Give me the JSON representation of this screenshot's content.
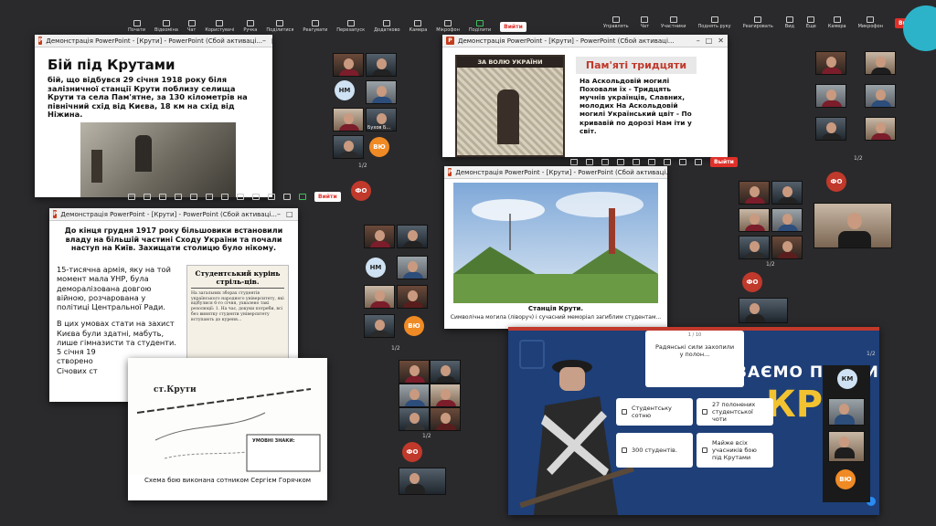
{
  "toolbar_left": {
    "items": [
      "Почати",
      "Відеоміна",
      "Чат",
      "Користувачі",
      "Ручка",
      "Поділитися",
      "Реагувати",
      "Перезапуск",
      "Додатково"
    ],
    "camera": "Камера",
    "mic": "Мікрофон",
    "sub": "Поділити",
    "leave": "Вийти"
  },
  "toolbar_right": {
    "items": [
      "Управлять",
      "Чат",
      "Участники",
      "Поднять руку",
      "Реагировать",
      "Вид",
      "Еще"
    ],
    "camera": "Камера",
    "mic": "Микрофон",
    "leave": "Выйти",
    "count": "17"
  },
  "win1": {
    "title": "Демонстрація PowerPoint - [Крути] - PowerPoint (Сбой активаці...",
    "heading": "Бій під Крутами",
    "body": "бій, що відбувся 29 січня 1918 року біля залізничної станції Крути поблизу селища Крути та села Пам'ятне, за 130 кілометрів на північний схід від Києва, 18 км на схід від Ніжина."
  },
  "win2": {
    "title": "Демонстрація PowerPoint - [Крути] - PowerPoint (Сбой активаці...",
    "lead": "До кінця грудня 1917 року більшовики встановили владу на більшій частині Сходу України та почали наступ на Київ. Захищати столицю було нікому.",
    "para1": "15-тисячна армія, яку на той момент мала УНР, була деморалізована довгою війною, розчарована у політиці Центральної Ради.",
    "para2": "В цих умовах стати на захист Києва були здатні, мабуть, лише гімназисти та студенти.",
    "date_partial": "5 січня 19",
    "created_partial": "створено",
    "sich_partial": "Січових ст",
    "newspaper_title": "Студентський курінь стріль-ців.",
    "newspaper_text": "На загальних зборах студентів українського народного університету, які відбулися 6-го січня, ухвалено такі резолюції: 1. На час, докуки потреби, всі без винятку студенти університету вступають до куреня..."
  },
  "map": {
    "station": "ст.Крути",
    "legend": "УМОВНІ ЗНАКИ:",
    "caption": "Схема бою виконана сотником Сергієм Горячком"
  },
  "win3": {
    "title": "Демонстрація PowerPoint - [Крути] - PowerPoint (Сбой активаці...",
    "poster": "ЗА ВОЛЮ УКРАЇНИ",
    "poem_title": "Пам'яті тридцяти",
    "poem": "На Аскольдовій могилі Поховали їх - Тридцять мучнів українців, Славних, молодих На Аскольдовій могилі Український цвіт - По кривавій по дорозі Нам іти у світ."
  },
  "win4": {
    "title": "Демонстрація PowerPoint - [Крути] - PowerPoint (Сбой активаці...",
    "station": "Станція Крути.",
    "caption": "Символічна могила (ліворуч) і сучасний меморіал загиблим студентам..."
  },
  "quiz": {
    "counter": "1 / 10",
    "question": "Радянські сили захопили у полон...",
    "banner": "ВАЄМО ПОДВИ",
    "banner2": "КР",
    "options": [
      "Студентську сотню",
      "27 полонених студентської чоти",
      "300 студентів.",
      "Майже всіх учасників бою під Крутами"
    ]
  },
  "participants": {
    "initials": [
      "НМ",
      "ВЮ",
      "ФО",
      "КМ"
    ],
    "names": [
      "Бухов Б..."
    ],
    "pages": [
      "1/2",
      "1/2",
      "1/2",
      "1/2",
      "1/2",
      "1/2"
    ]
  },
  "colors": {
    "accent": "#2a8bf2",
    "leave_red": "#e0302a",
    "corner_teal": "#2cb3c9"
  }
}
